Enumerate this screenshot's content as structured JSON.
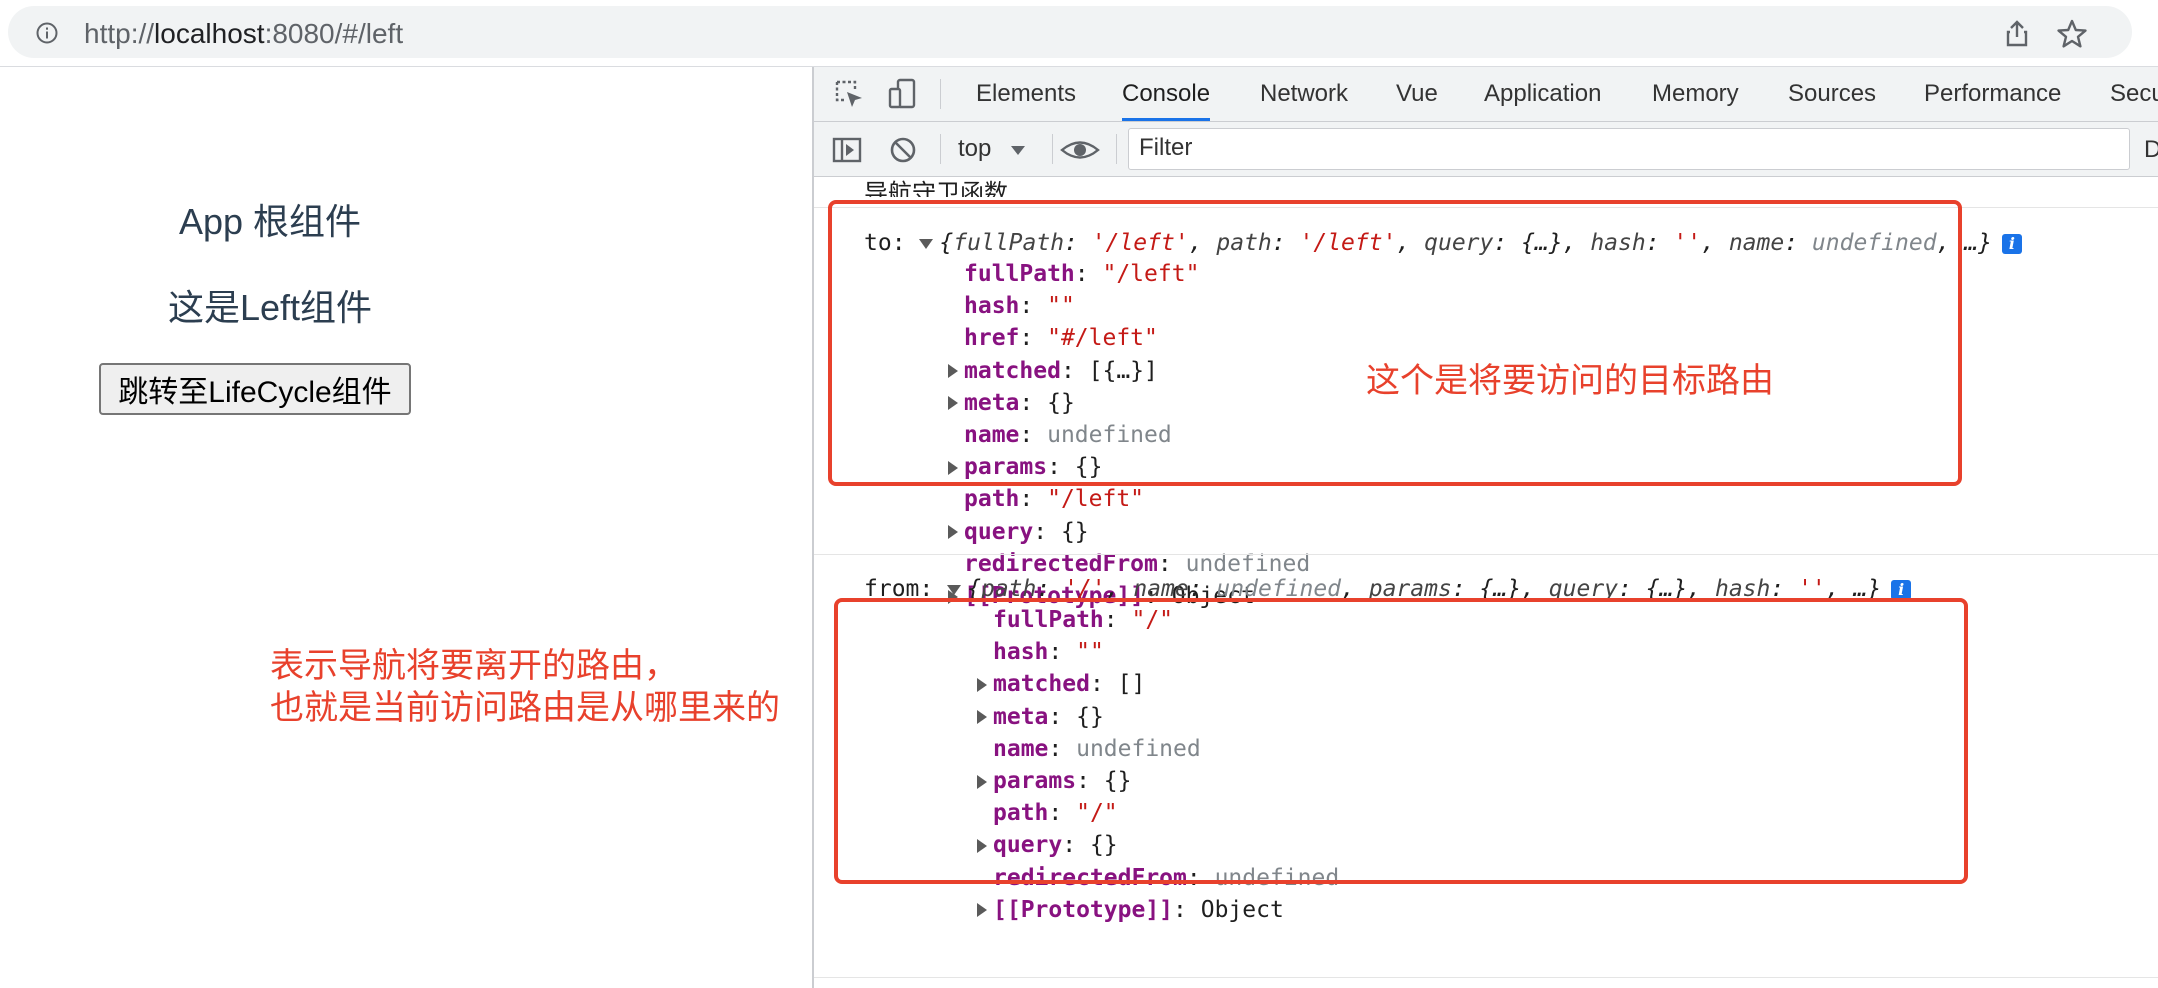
{
  "browser": {
    "url_prefix": "http://",
    "url_host": "localhost",
    "url_rest": ":8080/#/left"
  },
  "app": {
    "title": "App 根组件",
    "subtitle": "这是Left组件",
    "button_label": "跳转至LifeCycle组件"
  },
  "devtools": {
    "tabs": [
      "Elements",
      "Console",
      "Network",
      "Vue",
      "Application",
      "Memory",
      "Sources",
      "Performance",
      "Secu"
    ],
    "active_tab": "Console",
    "context": "top",
    "filter_placeholder": "Filter",
    "toolbar_right": "D"
  },
  "console": {
    "header_msg": "导航守卫函数...",
    "to_label": "to:",
    "to_summary": {
      "open": "{",
      "k1": "fullPath",
      "v1": "'/left'",
      "k2": "path",
      "v2": "'/left'",
      "k3": "query",
      "v3": "{…}",
      "k4": "hash",
      "v4": "''",
      "k5": "name",
      "v5": "undefined",
      "tail": ", …}"
    },
    "to_props": [
      {
        "key": "fullPath",
        "value": "\"/left\"",
        "type": "string",
        "expandable": false
      },
      {
        "key": "hash",
        "value": "\"\"",
        "type": "string",
        "expandable": false
      },
      {
        "key": "href",
        "value": "\"#/left\"",
        "type": "string",
        "expandable": false
      },
      {
        "key": "matched",
        "value": "[{…}]",
        "type": "plain",
        "expandable": true
      },
      {
        "key": "meta",
        "value": "{}",
        "type": "plain",
        "expandable": true
      },
      {
        "key": "name",
        "value": "undefined",
        "type": "undef",
        "expandable": false
      },
      {
        "key": "params",
        "value": "{}",
        "type": "plain",
        "expandable": true
      },
      {
        "key": "path",
        "value": "\"/left\"",
        "type": "string",
        "expandable": false
      },
      {
        "key": "query",
        "value": "{}",
        "type": "plain",
        "expandable": true
      },
      {
        "key": "redirectedFrom",
        "value": "undefined",
        "type": "undef",
        "expandable": false
      },
      {
        "key": "[[Prototype]]",
        "value": "Object",
        "type": "plain",
        "expandable": true
      }
    ],
    "from_label": "from:",
    "from_summary": {
      "open": "{",
      "k1": "path",
      "v1": "'/'",
      "k2": "name",
      "v2": "undefined",
      "k3": "params",
      "v3": "{…}",
      "k4": "query",
      "v4": "{…}",
      "k5": "hash",
      "v5": "''",
      "tail": ", …}"
    },
    "from_props": [
      {
        "key": "fullPath",
        "value": "\"/\"",
        "type": "string",
        "expandable": false
      },
      {
        "key": "hash",
        "value": "\"\"",
        "type": "string",
        "expandable": false
      },
      {
        "key": "matched",
        "value": "[]",
        "type": "plain",
        "expandable": true
      },
      {
        "key": "meta",
        "value": "{}",
        "type": "plain",
        "expandable": true
      },
      {
        "key": "name",
        "value": "undefined",
        "type": "undef",
        "expandable": false
      },
      {
        "key": "params",
        "value": "{}",
        "type": "plain",
        "expandable": true
      },
      {
        "key": "path",
        "value": "\"/\"",
        "type": "string",
        "expandable": false
      },
      {
        "key": "query",
        "value": "{}",
        "type": "plain",
        "expandable": true
      },
      {
        "key": "redirectedFrom",
        "value": "undefined",
        "type": "undef",
        "expandable": false
      },
      {
        "key": "[[Prototype]]",
        "value": "Object",
        "type": "plain",
        "expandable": true
      }
    ],
    "info_badge": "i"
  },
  "annotations": {
    "to_note": "这个是将要访问的目标路由",
    "from_note": "表示导航将要离开的路由，\n也就是当前访问路由是从哪里来的",
    "color": "#e8412c"
  }
}
